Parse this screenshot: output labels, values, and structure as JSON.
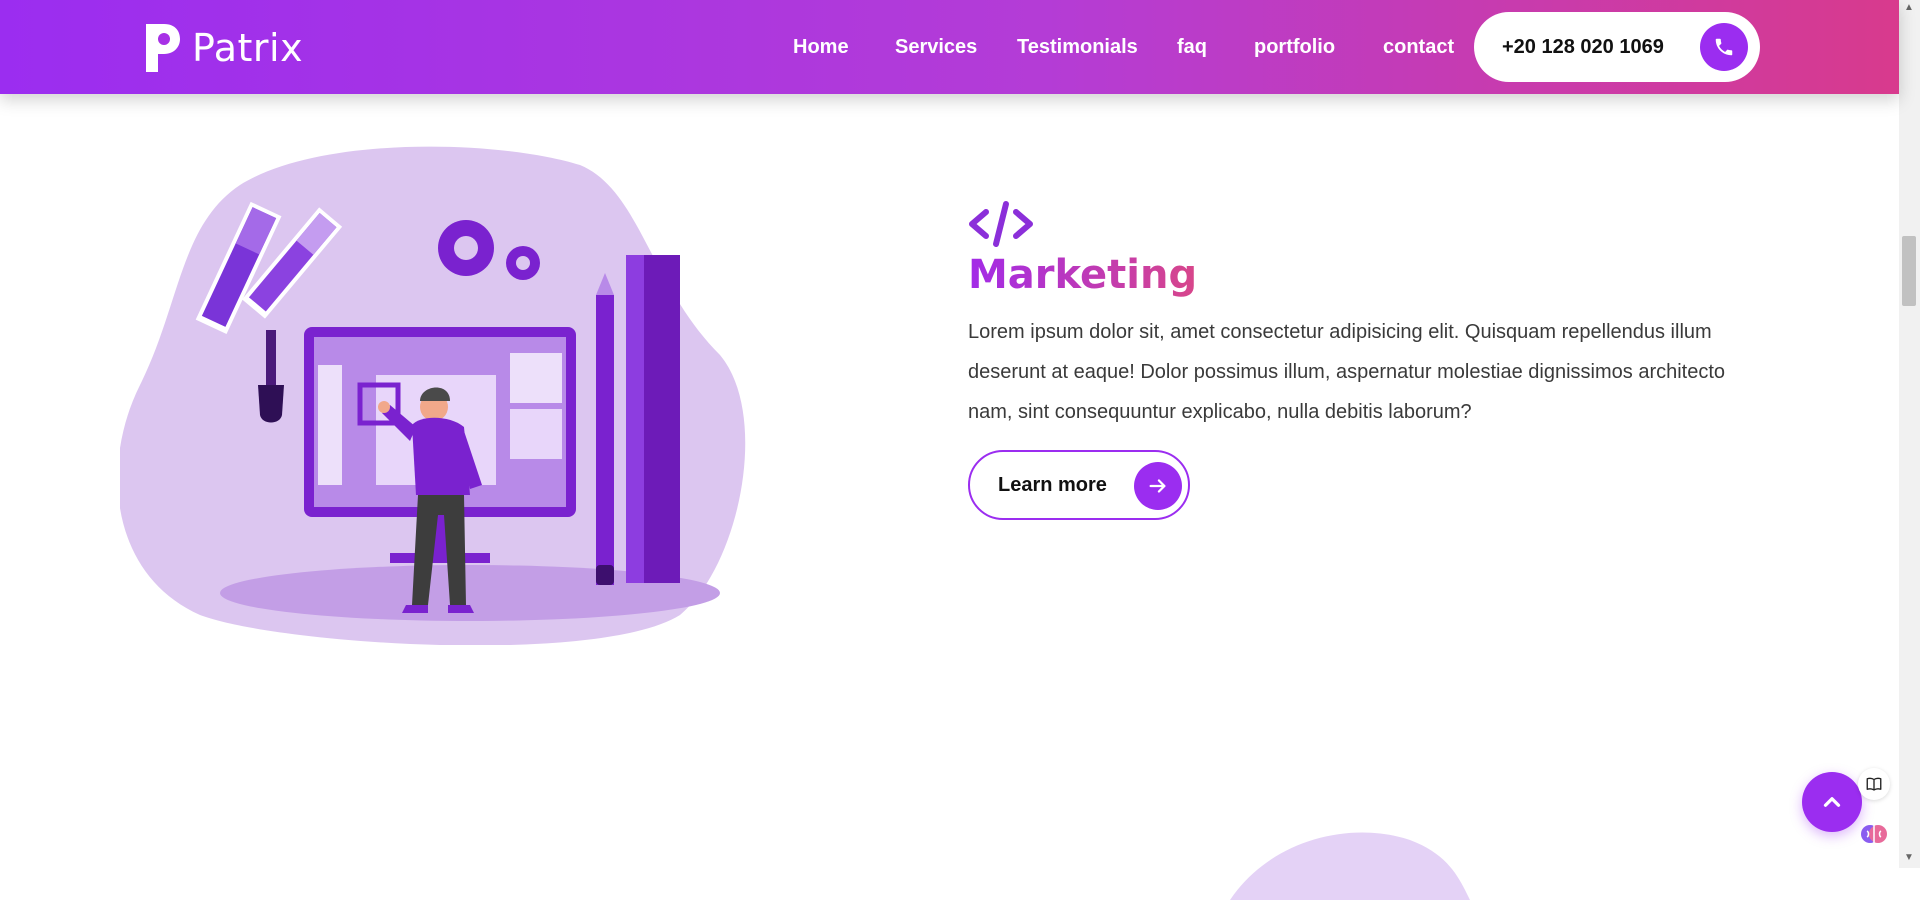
{
  "header": {
    "logo_text": "Patrix",
    "nav": [
      {
        "label": "Home"
      },
      {
        "label": "Services"
      },
      {
        "label": "Testimonials"
      },
      {
        "label": "faq"
      },
      {
        "label": "portfolio"
      },
      {
        "label": "contact"
      }
    ],
    "phone": "+20 128 020 1069",
    "phone_icon": "phone-icon"
  },
  "section": {
    "icon": "code-icon",
    "title": "Marketing",
    "text": "Lorem ipsum dolor sit, amet consectetur adipisicing elit. Quisquam repellendus illum deserunt at eaque! Dolor possimus illum, aspernatur molestiae dignissimos architecto nam, sint consequuntur explicabo, nulla debitis laborum?",
    "button_label": "Learn more",
    "button_icon": "arrow-right-icon"
  },
  "floating": {
    "to_top_icon": "chevron-up-icon",
    "side_icons": [
      "book-icon",
      "brain-icon"
    ]
  },
  "colors": {
    "accent": "#9b2df0",
    "gradient_start": "#9b2df0",
    "gradient_end": "#d83a8d",
    "illustration_bg": "#dcc6f0"
  }
}
